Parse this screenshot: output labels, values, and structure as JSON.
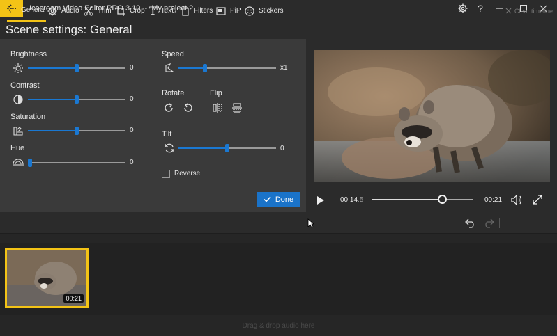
{
  "window": {
    "app_title": "Icecream Video Editor PRO 3.19",
    "separator": "-",
    "project_name": "My project 2"
  },
  "header": {
    "title": "Scene settings: General"
  },
  "adjustments": {
    "brightness": {
      "label": "Brightness",
      "value": "0",
      "position": 0.5
    },
    "contrast": {
      "label": "Contrast",
      "value": "0",
      "position": 0.5
    },
    "saturation": {
      "label": "Saturation",
      "value": "0",
      "position": 0.5
    },
    "hue": {
      "label": "Hue",
      "value": "0",
      "position": 0.0
    }
  },
  "speed": {
    "label": "Speed",
    "value": "x1",
    "position": 0.27
  },
  "rotate": {
    "label": "Rotate"
  },
  "flip": {
    "label": "Flip"
  },
  "tilt": {
    "label": "Tilt",
    "value": "0",
    "position": 0.5
  },
  "reverse": {
    "label": "Reverse",
    "checked": false
  },
  "done_label": "Done",
  "player": {
    "current_time": "00:14",
    "current_time_frac": ".5",
    "duration": "00:21",
    "progress": 0.69
  },
  "toolbar": {
    "general": "General",
    "audio": "Audio",
    "trim": "Trim",
    "crop": "Crop",
    "text": "Text",
    "filters": "Filters",
    "pip": "PiP",
    "stickers": "Stickers",
    "clear_timeline": "Clear timeline"
  },
  "timeline": {
    "clip_duration": "00:21",
    "audio_placeholder": "Drag & drop audio here"
  },
  "colors": {
    "accent": "#f3c316",
    "slider": "#1a78d2",
    "done_button": "#1a73c9",
    "panel": "#3a3a3a",
    "background": "#2b2b2b"
  }
}
